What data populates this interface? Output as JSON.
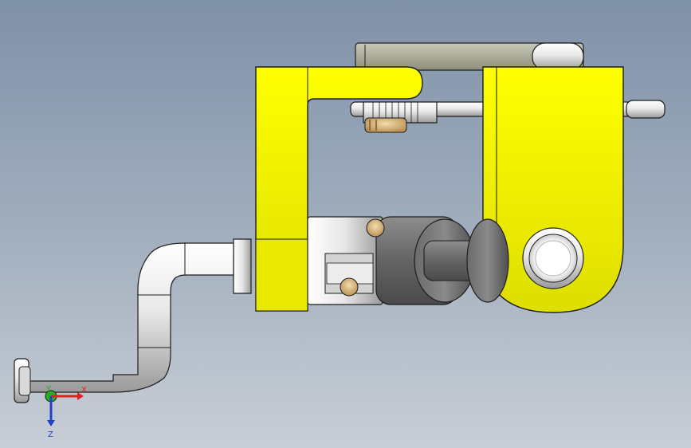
{
  "viewport": {
    "background": {
      "top": "#7f91a8",
      "mid": "#a4b0bf",
      "bottom": "#c8ced6"
    }
  },
  "model": {
    "colors": {
      "yellow": "#ffff00",
      "yellow_shade": "#d9d900",
      "metal_light": "#f5f5f5",
      "metal_mid": "#d9d9d9",
      "metal_dark": "#6d6d6d",
      "gold": "#d8b77a",
      "outline": "#1d1d1d"
    }
  },
  "triad": {
    "x_label": "X",
    "y_label": "Y",
    "z_label": "Z",
    "x_color": "#e02020",
    "y_color": "#20b020",
    "z_color": "#2040d0"
  }
}
